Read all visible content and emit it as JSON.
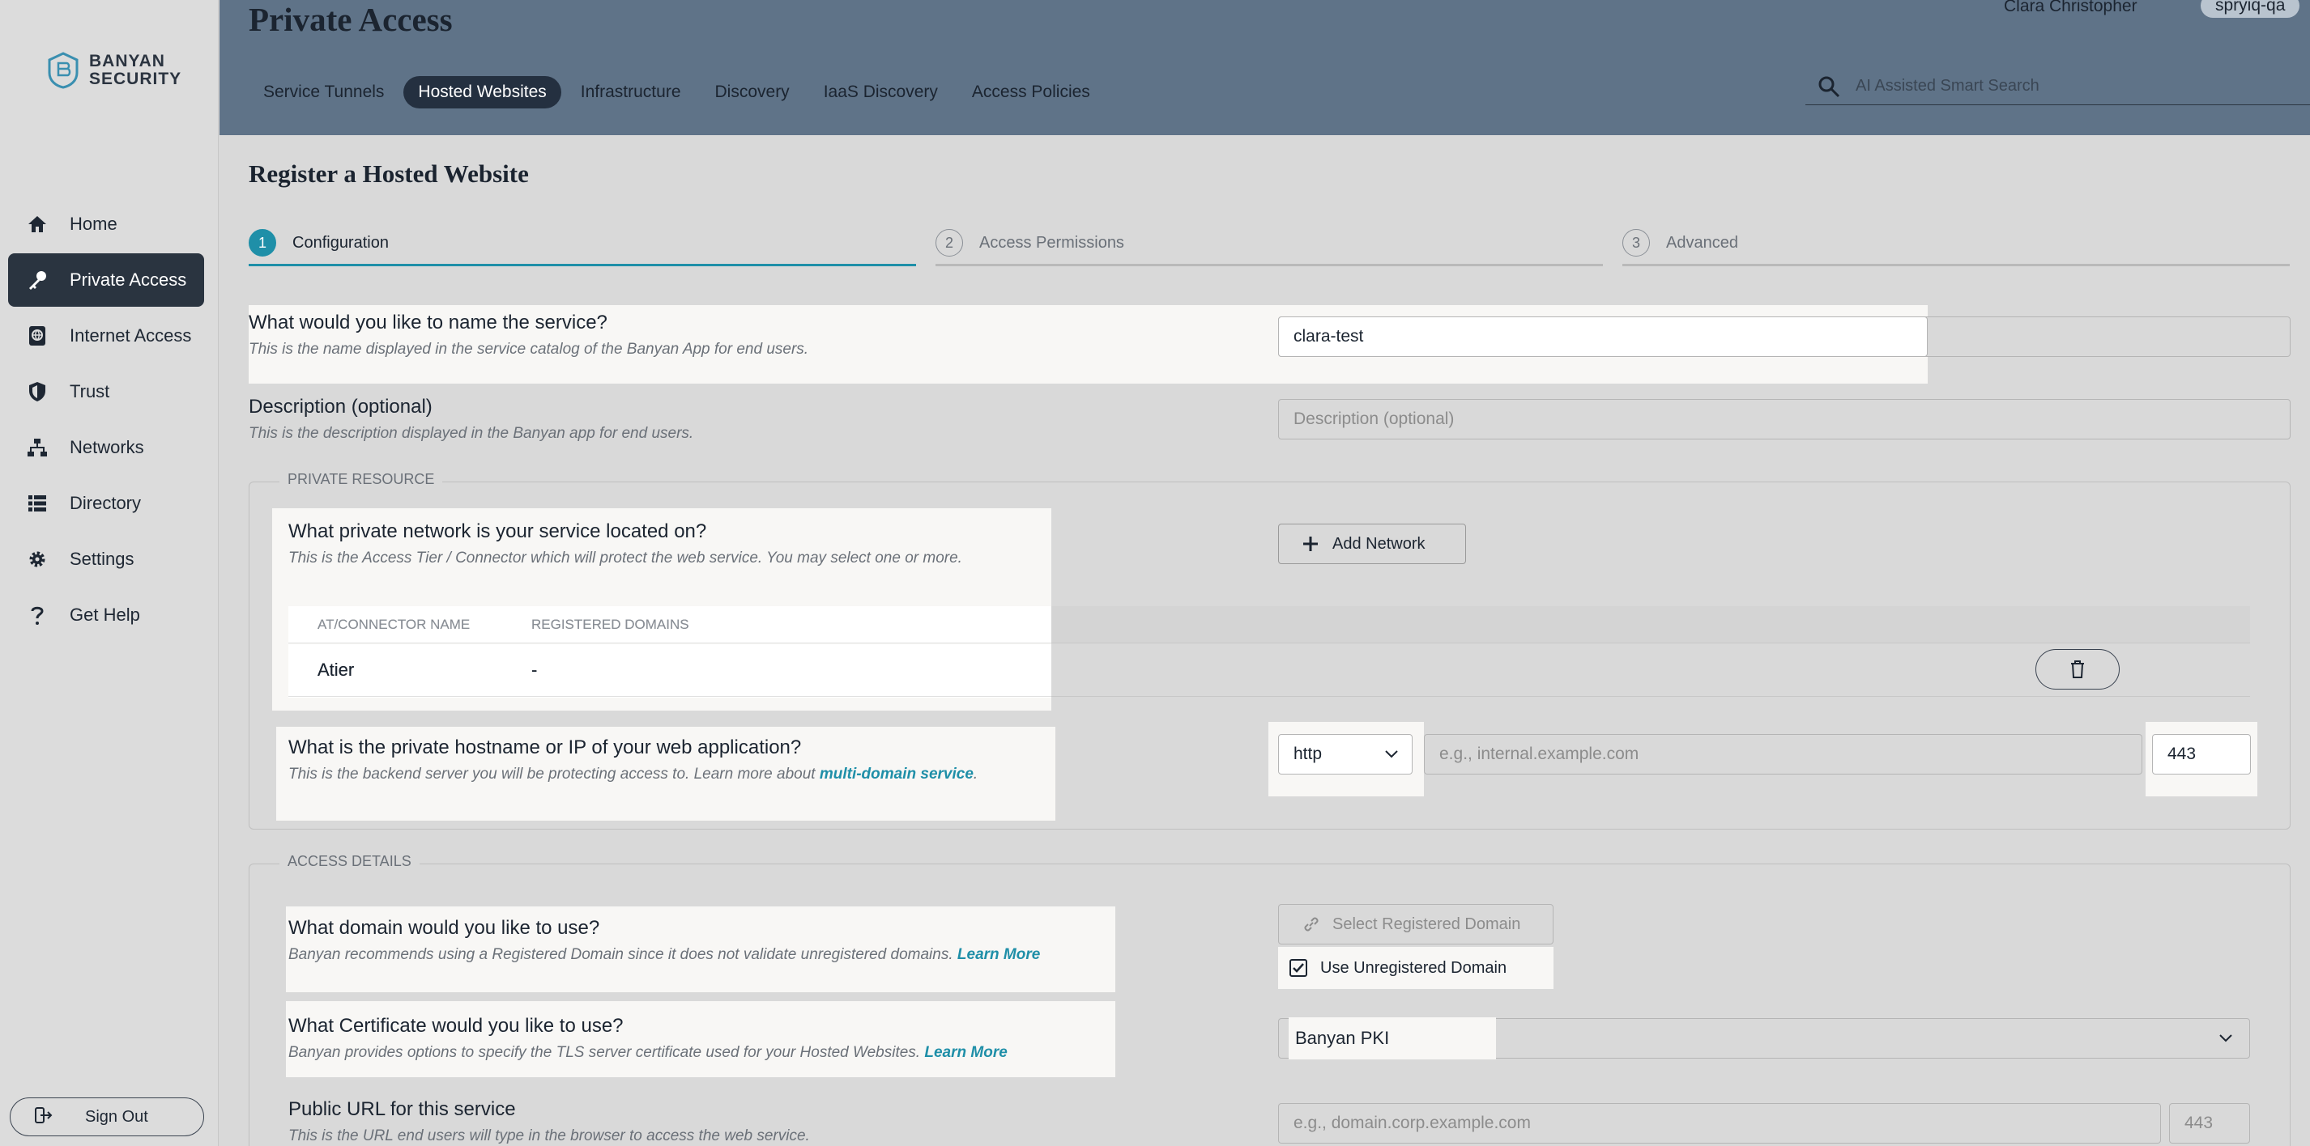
{
  "brand": {
    "line1": "BANYAN",
    "line2": "SECURITY"
  },
  "sidebar": {
    "items": [
      {
        "label": "Home",
        "icon": "home-icon"
      },
      {
        "label": "Private Access",
        "icon": "key-icon",
        "active": true
      },
      {
        "label": "Internet Access",
        "icon": "internet-icon"
      },
      {
        "label": "Trust",
        "icon": "shield-icon"
      },
      {
        "label": "Networks",
        "icon": "network-icon"
      },
      {
        "label": "Directory",
        "icon": "list-icon"
      },
      {
        "label": "Settings",
        "icon": "gear-icon"
      },
      {
        "label": "Get Help",
        "icon": "question-icon"
      }
    ],
    "sign_out": "Sign Out"
  },
  "header": {
    "title": "Private Access",
    "user": "Clara Christopher",
    "org": "spryiq-qa",
    "tabs": [
      {
        "label": "Service Tunnels"
      },
      {
        "label": "Hosted Websites",
        "active": true
      },
      {
        "label": "Infrastructure"
      },
      {
        "label": "Discovery"
      },
      {
        "label": "IaaS Discovery"
      },
      {
        "label": "Access Policies"
      }
    ],
    "search_placeholder": "AI Assisted Smart Search"
  },
  "form": {
    "title": "Register a Hosted Website",
    "steps": [
      {
        "num": "1",
        "label": "Configuration",
        "active": true
      },
      {
        "num": "2",
        "label": "Access Permissions"
      },
      {
        "num": "3",
        "label": "Advanced"
      }
    ],
    "name": {
      "question": "What would you like to name the service?",
      "help": "This is the name displayed in the service catalog of the Banyan App for end users.",
      "value": "clara-test"
    },
    "description": {
      "question": "Description (optional)",
      "help": "This is the description displayed in the Banyan app for end users.",
      "placeholder": "Description (optional)"
    },
    "private_resource": {
      "legend": "PRIVATE RESOURCE",
      "network_question": "What private network is your service located on?",
      "network_help": "This is the Access Tier / Connector which will protect the web service. You may select one or more.",
      "add_network": "Add Network",
      "columns": [
        "AT/CONNECTOR NAME",
        "REGISTERED DOMAINS"
      ],
      "rows": [
        {
          "name": "Atier",
          "domains": "-"
        }
      ],
      "host_question": "What is the private hostname or IP of your web application?",
      "host_help": "This is the backend server you will be protecting access to. Learn more about",
      "host_help_link": "multi-domain service",
      "protocol": "http",
      "host_placeholder": "e.g., internal.example.com",
      "port": "443"
    },
    "access_details": {
      "legend": "ACCESS DETAILS",
      "domain_question": "What domain would you like to use?",
      "domain_help": "Banyan recommends using a Registered Domain since it does not validate unregistered domains.",
      "learn_more": "Learn More",
      "select_domain": "Select Registered Domain",
      "use_unregistered": "Use Unregistered Domain",
      "cert_question": "What Certificate would you like to use?",
      "cert_help": "Banyan provides options to specify the TLS server certificate used for your Hosted Websites.",
      "cert_value": "Banyan PKI",
      "url_question": "Public URL for this service",
      "url_help": "This is the URL end users will type in the browser to access the web service.",
      "url_placeholder": "e.g., domain.corp.example.com",
      "url_port": "443"
    }
  },
  "colors": {
    "accent": "#1f8fa8",
    "nav_active": "#2a3440",
    "header_bg": "#5f7388"
  }
}
